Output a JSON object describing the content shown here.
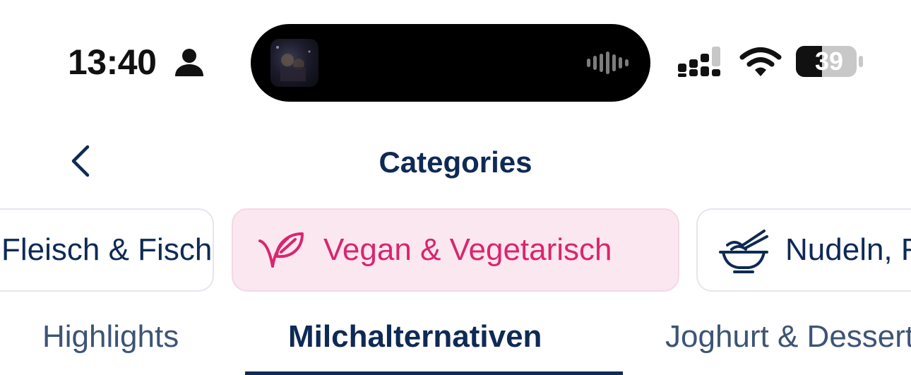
{
  "status_bar": {
    "time": "13:40",
    "battery_level": "39",
    "icons": [
      "person-icon",
      "signal-icon",
      "wifi-icon",
      "battery-icon"
    ]
  },
  "dynamic_island": {
    "icons": [
      "album-art-icon",
      "audio-waveform-icon"
    ]
  },
  "nav": {
    "title": "Categories",
    "back_icon": "chevron-left-icon"
  },
  "categories": [
    {
      "label": "Fleisch & Fisch",
      "selected": false
    },
    {
      "label": "Vegan & Vegetarisch",
      "icon": "leaf-icon",
      "selected": true
    },
    {
      "label": "Nudeln, Reis & Getreide",
      "icon": "noodle-bowl-icon",
      "selected": false
    }
  ],
  "subtabs": [
    {
      "label": "Highlights",
      "selected": false
    },
    {
      "label": "Milchalternativen",
      "selected": true
    },
    {
      "label": "Joghurt & Desserts",
      "selected": false
    }
  ],
  "colors": {
    "primary": "#0e2a55",
    "accent": "#d9256f",
    "selected_chip_bg": "#fbe7ef",
    "subtab_inactive": "#3c5476"
  }
}
